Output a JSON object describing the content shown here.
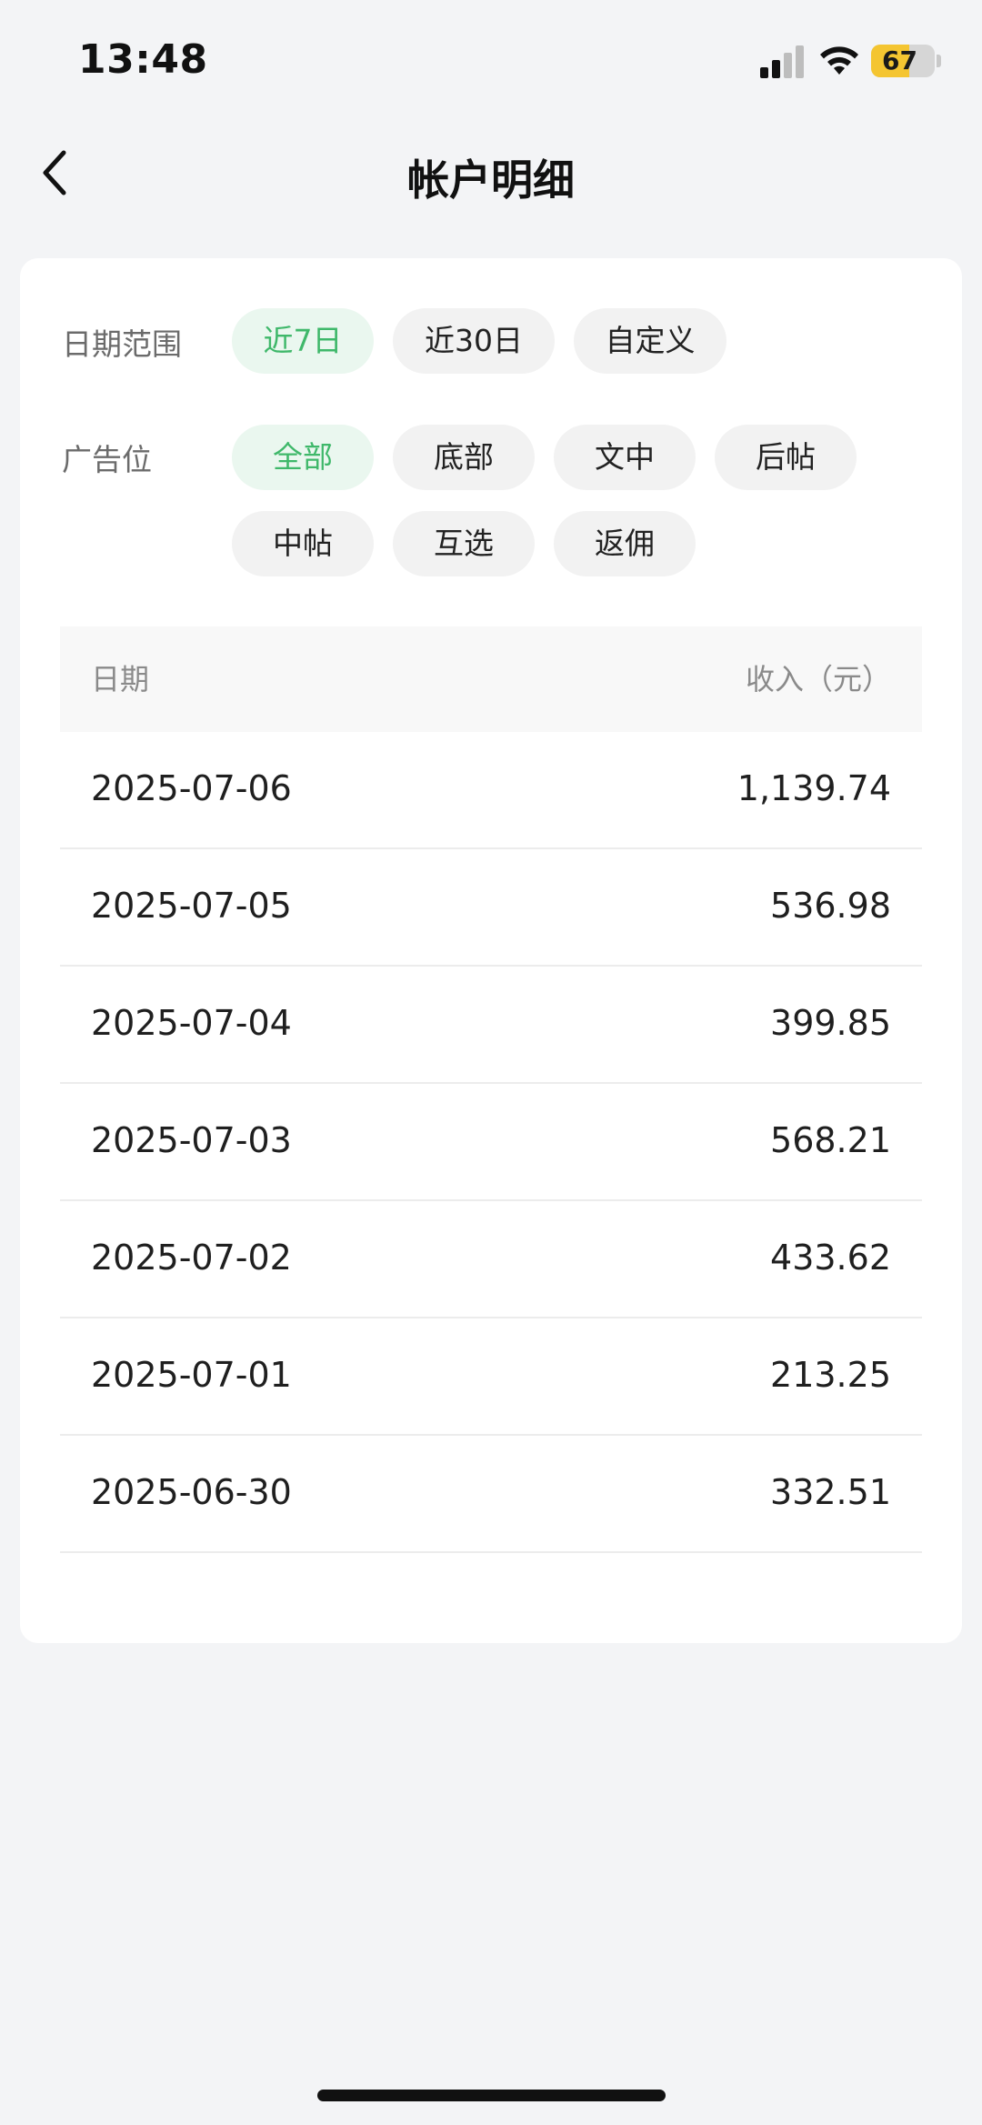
{
  "status_bar": {
    "time": "13:48",
    "battery_level": "67",
    "battery_percent": 67,
    "icons": [
      "signal-icon",
      "wifi-icon",
      "battery-icon"
    ]
  },
  "nav": {
    "title": "帐户明细",
    "back_icon": "chevron-left-icon"
  },
  "filters": {
    "date_range": {
      "label": "日期范围",
      "options": [
        "近7日",
        "近30日",
        "自定义"
      ],
      "selected": "近7日"
    },
    "ad_slot": {
      "label": "广告位",
      "options": [
        "全部",
        "底部",
        "文中",
        "后帖",
        "中帖",
        "互选",
        "返佣"
      ],
      "selected": "全部"
    }
  },
  "table": {
    "headers": {
      "date": "日期",
      "income": "收入（元）"
    },
    "rows": [
      {
        "date": "2025-07-06",
        "income": "1,139.74"
      },
      {
        "date": "2025-07-05",
        "income": "536.98"
      },
      {
        "date": "2025-07-04",
        "income": "399.85"
      },
      {
        "date": "2025-07-03",
        "income": "568.21"
      },
      {
        "date": "2025-07-02",
        "income": "433.62"
      },
      {
        "date": "2025-07-01",
        "income": "213.25"
      },
      {
        "date": "2025-06-30",
        "income": "332.51"
      }
    ]
  },
  "colors": {
    "accent": "#3fb86a",
    "accent_bg": "#eaf7ef",
    "page_bg": "#f3f4f6",
    "battery": "#f4c531"
  }
}
